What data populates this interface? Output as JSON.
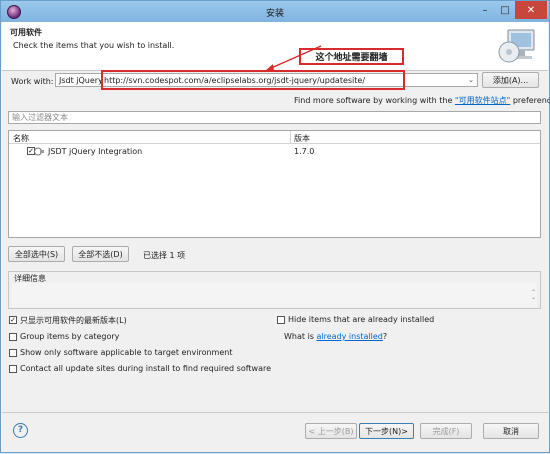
{
  "window": {
    "title": "安装",
    "minimize_glyph": "–",
    "maximize_glyph": "□",
    "close_glyph": "✕"
  },
  "header": {
    "title": "可用软件",
    "subtitle": "Check the items that you wish to install.",
    "icon": "install-software-monitor-icon"
  },
  "annotation": {
    "text": "这个地址需要翻墙",
    "color": "#d92b2b"
  },
  "work_with": {
    "label": "Work with:",
    "site_name": "Jsdt jQuery",
    "separator": "-",
    "url": "http://svn.codespot.com/a/eclipselabs.org/jsdt-jquery/updatesite/",
    "add_button": "添加(A)...",
    "more_prefix": "Find more software by working with the ",
    "more_link": "\"可用软件站点\"",
    "more_suffix": " preferences."
  },
  "filter": {
    "placeholder": "输入过滤器文本"
  },
  "table": {
    "columns": [
      "名称",
      "版本"
    ],
    "rows": [
      {
        "checked": true,
        "name": "JSDT jQuery Integration",
        "version": "1.7.0"
      }
    ]
  },
  "selection": {
    "select_all": "全部选中(S)",
    "deselect_all": "全部不选(D)",
    "status": "已选择 1 项"
  },
  "details": {
    "label": "详细信息"
  },
  "options": {
    "latest_only": {
      "label": "只显示可用软件的最新版本(L)",
      "checked": true
    },
    "group_by_category": {
      "label": "Group items by category",
      "checked": false
    },
    "target_env": {
      "label": "Show only software applicable to target environment",
      "checked": false
    },
    "contact_sites": {
      "label": "Contact all update sites during install to find required software",
      "checked": false
    },
    "hide_installed": {
      "label": "Hide items that are already installed",
      "checked": false
    },
    "what_is_prefix": "What is ",
    "what_is_link": "already installed",
    "what_is_suffix": "?"
  },
  "footer": {
    "back": "< 上一步(B)",
    "next": "下一步(N)>",
    "finish": "完成(F)",
    "cancel": "取消",
    "help_glyph": "?"
  },
  "colors": {
    "titlebar": "#8fbfe6",
    "close": "#c8463c",
    "link": "#0066cc"
  }
}
